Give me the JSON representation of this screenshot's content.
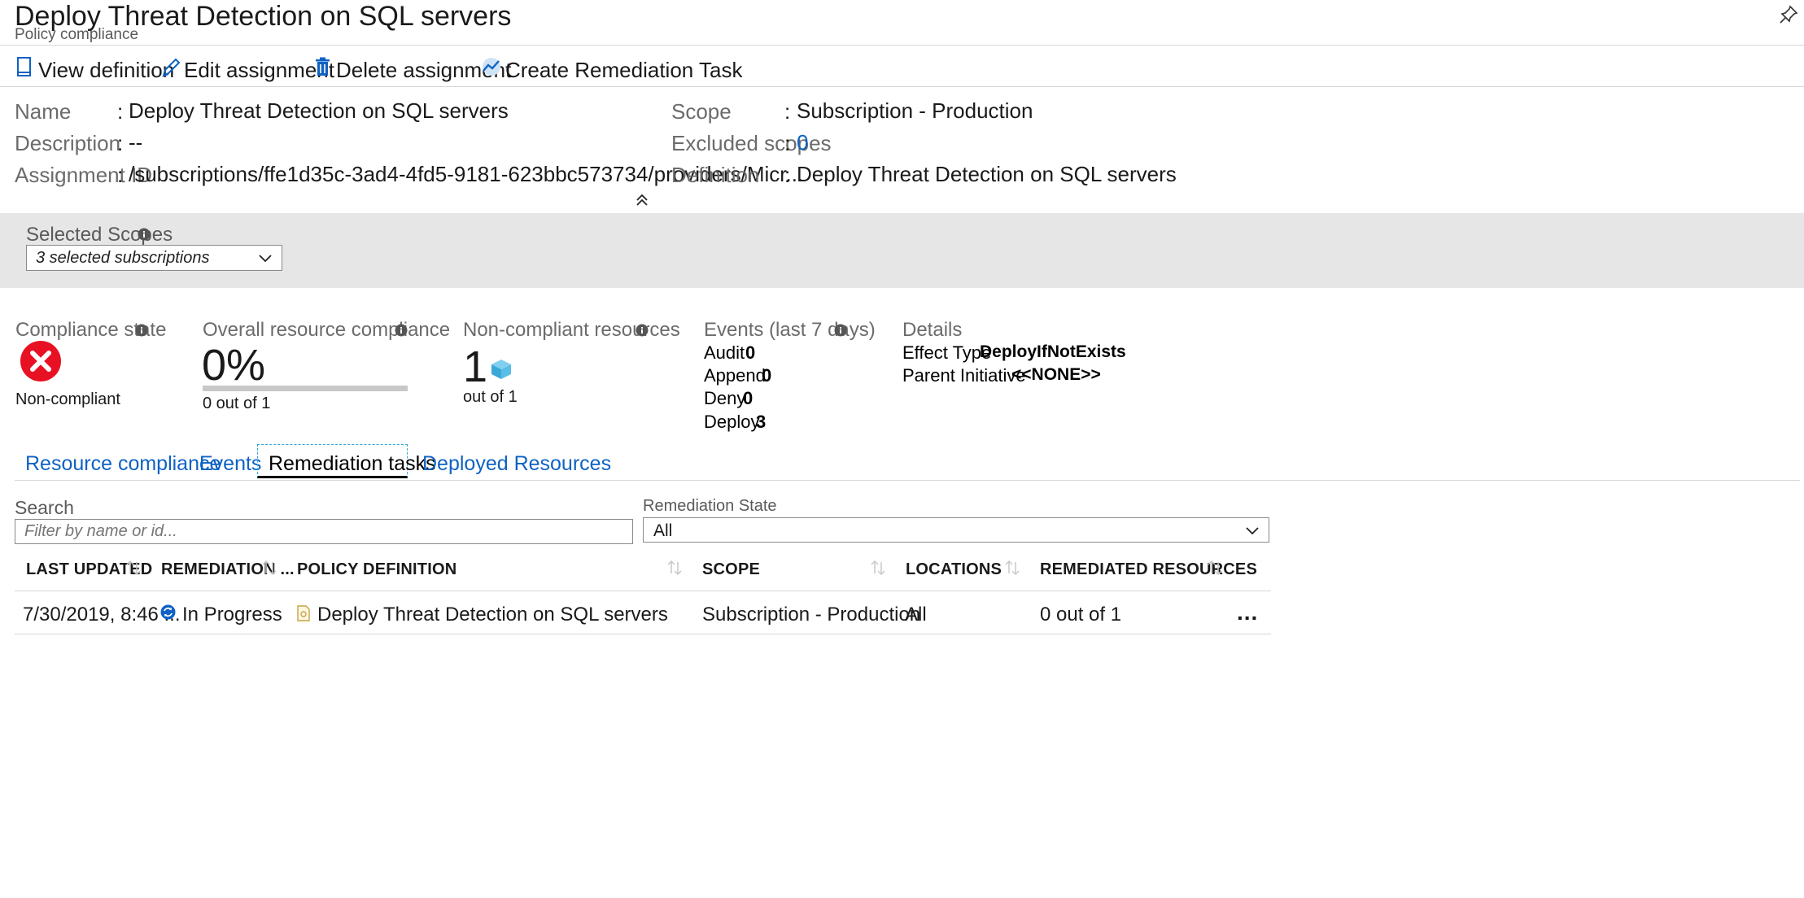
{
  "header": {
    "title": "Deploy Threat Detection on SQL servers",
    "subtitle": "Policy compliance",
    "pin_icon": "pin-icon"
  },
  "toolbar": {
    "view_definition": "View definition",
    "edit_assignment": "Edit assignment",
    "delete_assignment": "Delete assignment",
    "create_remediation": "Create Remediation Task"
  },
  "essentials": {
    "name_label": "Name",
    "name_value": "Deploy Threat Detection on SQL servers",
    "description_label": "Description",
    "description_value": "--",
    "assignment_id_label": "Assignment ID",
    "assignment_id_value": "/subscriptions/ffe1d35c-3ad4-4fd5-9181-623bbc573734/providers/Micr...",
    "scope_label": "Scope",
    "scope_value": "Subscription - Production",
    "excluded_label": "Excluded scopes",
    "excluded_value": "0",
    "definition_label": "Definition",
    "definition_value": "Deploy Threat Detection on SQL servers",
    "separator": ":"
  },
  "scopes": {
    "label": "Selected Scopes",
    "selected": "3 selected subscriptions"
  },
  "summary": {
    "compliance_state_label": "Compliance state",
    "compliance_state_value": "Non-compliant",
    "overall_label": "Overall resource compliance",
    "overall_percent": "0%",
    "overall_fraction": 0,
    "overall_sub": "0 out of 1",
    "noncompliant_label": "Non-compliant resources",
    "noncompliant_count": "1",
    "noncompliant_sub": "out of 1",
    "events_label": "Events (last 7 days)",
    "events": [
      {
        "label": "Audit",
        "value": "0"
      },
      {
        "label": "Append",
        "value": "0"
      },
      {
        "label": "Deny",
        "value": "0"
      },
      {
        "label": "Deploy",
        "value": "3"
      }
    ],
    "details_label": "Details",
    "effect_type_label": "Effect Type",
    "effect_type_value": "DeployIfNotExists",
    "parent_initiative_label": "Parent Initiative",
    "parent_initiative_value": "<<NONE>>"
  },
  "tabs": [
    {
      "label": "Resource compliance",
      "active": false
    },
    {
      "label": "Events",
      "active": false
    },
    {
      "label": "Remediation tasks",
      "active": true
    },
    {
      "label": "Deployed Resources",
      "active": false
    }
  ],
  "filters": {
    "search_label": "Search",
    "search_placeholder": "Filter by name or id...",
    "state_label": "Remediation State",
    "state_value": "All"
  },
  "table": {
    "columns": [
      "LAST UPDATED",
      "REMEDIATION ...",
      "POLICY DEFINITION",
      "SCOPE",
      "LOCATIONS",
      "REMEDIATED RESOURCES"
    ],
    "rows": [
      {
        "last_updated": "7/30/2019, 8:46 ...",
        "remediation_state": "In Progress",
        "policy_definition": "Deploy Threat Detection on SQL servers",
        "scope": "Subscription - Production",
        "locations": "All",
        "remediated_resources": "0 out of 1",
        "more": "..."
      }
    ]
  },
  "colors": {
    "accent": "#0f62c3",
    "error": "#e81123",
    "band": "#e6e6e6"
  }
}
